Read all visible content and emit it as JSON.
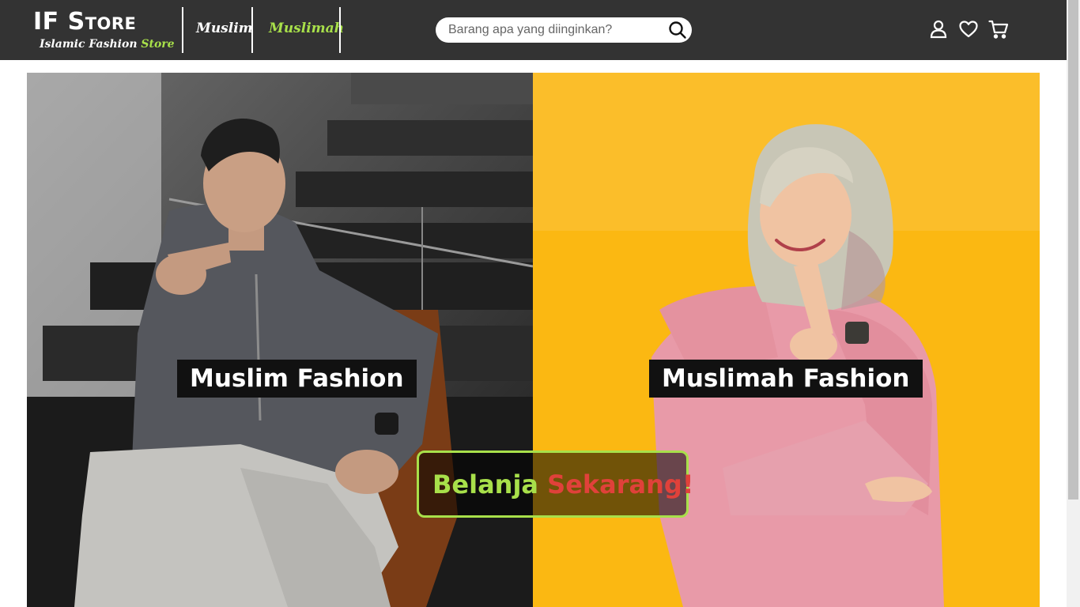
{
  "brand": {
    "title": "IF Store",
    "subtitle_main": "Islamic Fashion",
    "subtitle_accent": "Store"
  },
  "nav": {
    "links": [
      {
        "label": "Muslim",
        "color": "#ffffff"
      },
      {
        "label": "Muslimah",
        "color": "#a8e04a"
      }
    ]
  },
  "search": {
    "placeholder": "Barang apa yang diinginkan?",
    "value": ""
  },
  "header_icons": [
    "user-icon",
    "heart-icon",
    "cart-icon"
  ],
  "hero": {
    "left_label": "Muslim Fashion",
    "right_label": "Muslimah Fashion",
    "cta_part1": "Belanja",
    "cta_part2": "Sekarang!"
  },
  "colors": {
    "navbar": "#333333",
    "accent_green": "#a8e04a",
    "accent_red": "#e0413a",
    "hero_right_bg": "#fbb812"
  }
}
